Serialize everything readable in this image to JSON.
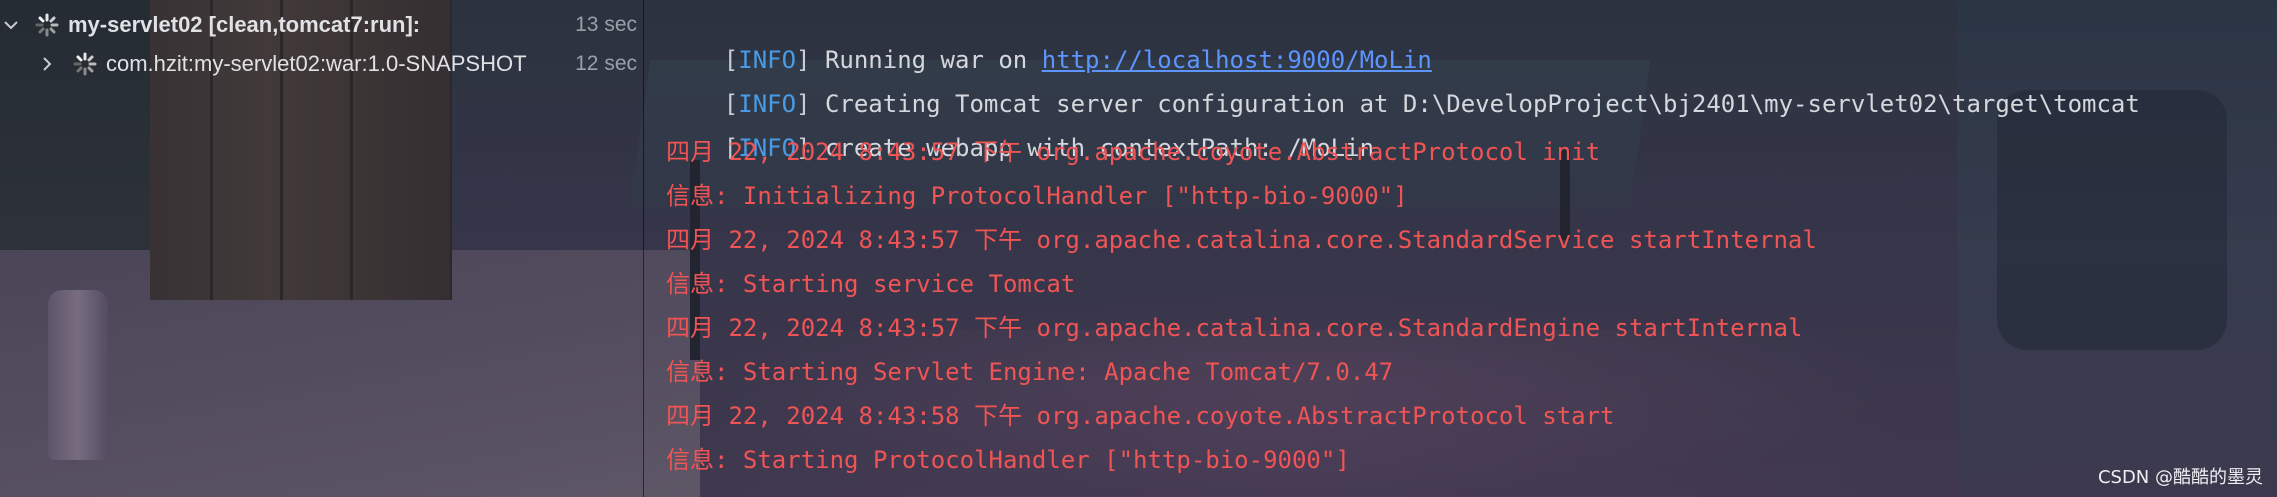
{
  "tree": {
    "items": [
      {
        "label": "my-servlet02 [clean,tomcat7:run]:",
        "time": "13 sec",
        "expanded": true
      },
      {
        "label": "com.hzit:my-servlet02:war:1.0-SNAPSHOT",
        "time": "12 sec",
        "expanded": false
      }
    ]
  },
  "console": {
    "info_lines": [
      {
        "level": "INFO",
        "text": "Running war on ",
        "link": "http://localhost:9000/MoLin"
      },
      {
        "level": "INFO",
        "text": "Creating Tomcat server configuration at D:\\DevelopProject\\bj2401\\my-servlet02\\target\\tomcat"
      },
      {
        "level": "INFO",
        "text": "create webapp with contextPath: /MoLin"
      }
    ],
    "error_lines": [
      "四月 22, 2024 8:43:57 下午 org.apache.coyote.AbstractProtocol init",
      "信息: Initializing ProtocolHandler [\"http-bio-9000\"]",
      "四月 22, 2024 8:43:57 下午 org.apache.catalina.core.StandardService startInternal",
      "信息: Starting service Tomcat",
      "四月 22, 2024 8:43:57 下午 org.apache.catalina.core.StandardEngine startInternal",
      "信息: Starting Servlet Engine: Apache Tomcat/7.0.47",
      "四月 22, 2024 8:43:58 下午 org.apache.coyote.AbstractProtocol start",
      "信息: Starting ProtocolHandler [\"http-bio-9000\"]"
    ]
  },
  "watermark": "CSDN @酷酷的墨灵",
  "colors": {
    "info_level": "#4a9be6",
    "link": "#5d95ff",
    "stderr": "#f05454",
    "text": "#d5d7dc"
  },
  "icons": {
    "expand": "chevron-down-icon",
    "collapse": "chevron-right-icon",
    "running": "spinner-icon"
  }
}
